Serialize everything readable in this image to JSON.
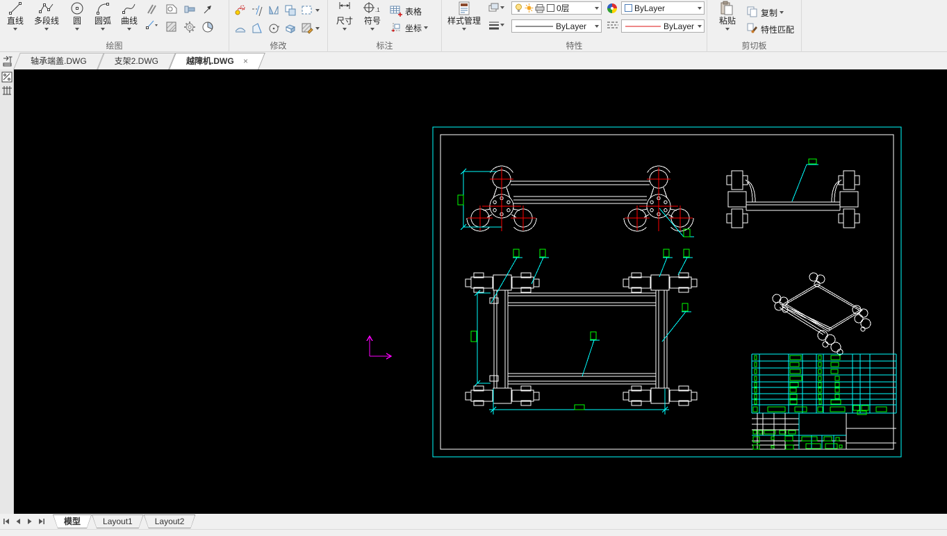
{
  "ribbon": {
    "draw": {
      "label": "绘图",
      "buttons": [
        {
          "label": "直线"
        },
        {
          "label": "多段线"
        },
        {
          "label": "圆"
        },
        {
          "label": "圆弧"
        },
        {
          "label": "曲线"
        }
      ]
    },
    "modify": {
      "label": "修改"
    },
    "annotate": {
      "label": "标注",
      "dimension": "尺寸",
      "symbol": "符号",
      "symbol_icon_text": ".1",
      "table": "表格",
      "coordinate": "坐标"
    },
    "properties": {
      "label": "特性",
      "style_manager": "样式管理",
      "layer_value": "0层",
      "color_value": "ByLayer",
      "lineweight_value": "ByLayer",
      "linetype_value": "ByLayer"
    },
    "clipboard": {
      "label": "剪切板",
      "paste": "粘贴",
      "copy": "复制",
      "match_properties": "特性匹配"
    }
  },
  "doc_tabs": {
    "tabs": [
      {
        "label": "轴承端盖.DWG"
      },
      {
        "label": "支架2.DWG"
      },
      {
        "label": "越障机.DWG"
      }
    ],
    "close_glyph": "×"
  },
  "layout_tabs": {
    "model": "模型",
    "layout1": "Layout1",
    "layout2": "Layout2"
  },
  "colors": {
    "canvas": "#000000",
    "drawing_border": "#00ffff",
    "geometry": "#ffffff",
    "labels": "#00ff00",
    "center_marks": "#ff0000",
    "ucs": "#ff00ff"
  }
}
